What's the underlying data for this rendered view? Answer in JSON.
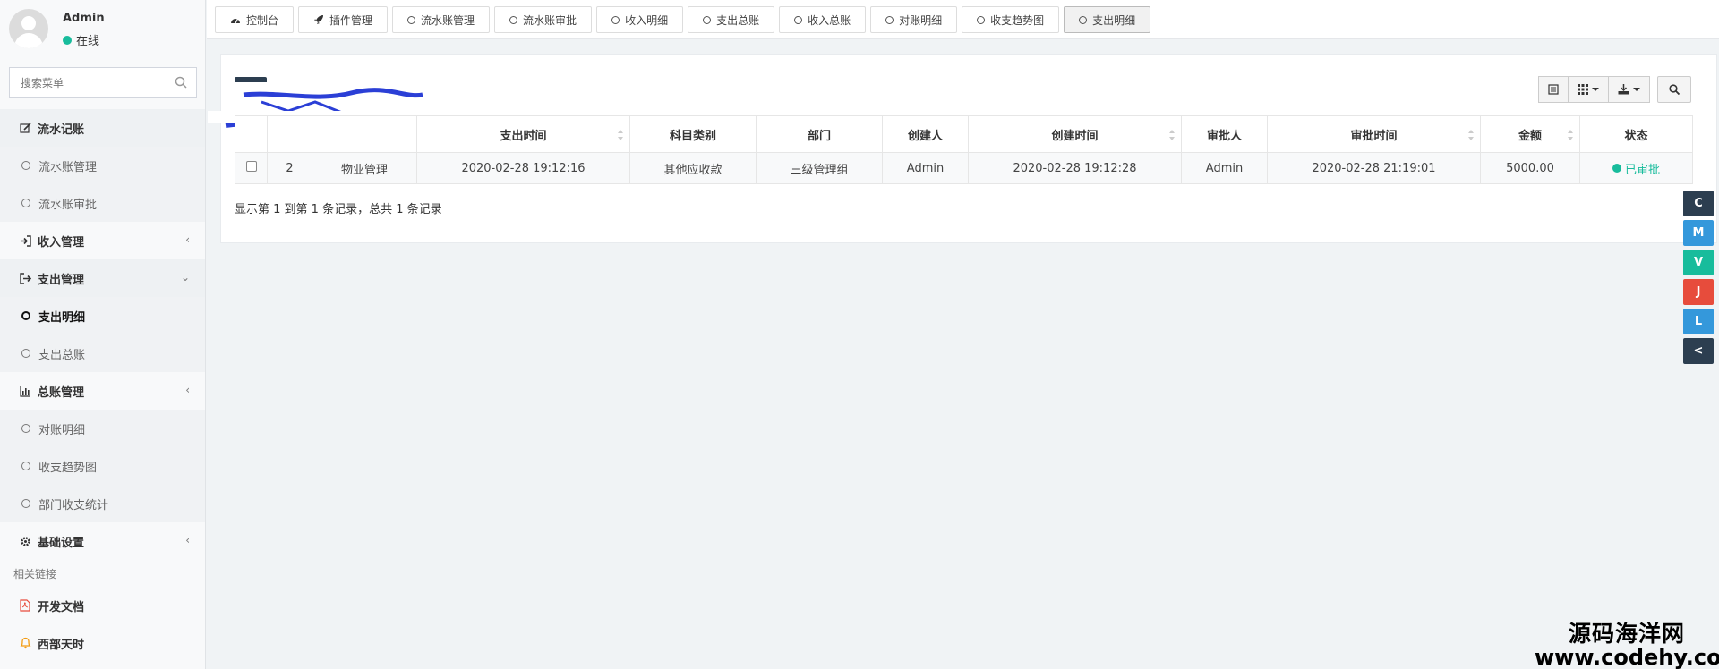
{
  "user": {
    "name": "Admin",
    "status": "在线",
    "status_color": "#18bc9c"
  },
  "sidebar": {
    "search_placeholder": "搜索菜单",
    "items": [
      {
        "label": "流水记账",
        "type": "parent",
        "icon": "edit-icon",
        "open": true
      },
      {
        "label": "流水账管理",
        "type": "child"
      },
      {
        "label": "流水账审批",
        "type": "child"
      },
      {
        "label": "收入管理",
        "type": "parent",
        "icon": "sign-in-icon",
        "arrow": "‹"
      },
      {
        "label": "支出管理",
        "type": "parent",
        "icon": "sign-out-icon",
        "arrow": "⌄",
        "open": true
      },
      {
        "label": "支出明细",
        "type": "child",
        "active": true
      },
      {
        "label": "支出总账",
        "type": "child"
      },
      {
        "label": "总账管理",
        "type": "parent",
        "icon": "bar-chart-icon",
        "arrow": "‹"
      },
      {
        "label": "对账明细",
        "type": "child"
      },
      {
        "label": "收支趋势图",
        "type": "child"
      },
      {
        "label": "部门收支统计",
        "type": "child"
      },
      {
        "label": "基础设置",
        "type": "parent",
        "icon": "gear-icon",
        "arrow": "‹"
      }
    ],
    "links_header": "相关链接",
    "links": [
      {
        "label": "开发文档",
        "icon": "pdf-icon"
      },
      {
        "label": "西部天时",
        "icon": "bell-icon"
      }
    ]
  },
  "tabs": [
    {
      "label": "控制台",
      "icon": "dashboard-icon"
    },
    {
      "label": "插件管理",
      "icon": "rocket-icon"
    },
    {
      "label": "流水账管理",
      "icon": "circle-icon"
    },
    {
      "label": "流水账审批",
      "icon": "circle-icon"
    },
    {
      "label": "收入明细",
      "icon": "circle-icon"
    },
    {
      "label": "支出总账",
      "icon": "circle-icon"
    },
    {
      "label": "收入总账",
      "icon": "circle-icon"
    },
    {
      "label": "对账明细",
      "icon": "circle-icon"
    },
    {
      "label": "收支趋势图",
      "icon": "circle-icon"
    },
    {
      "label": "支出明细",
      "icon": "circle-icon",
      "active": true
    }
  ],
  "table": {
    "columns": [
      "",
      "",
      "",
      "支出时间",
      "科目类别",
      "部门",
      "创建人",
      "创建时间",
      "审批人",
      "审批时间",
      "金额",
      "状态"
    ],
    "rows": [
      [
        "",
        "2",
        "物业管理",
        "2020-02-28 19:12:16",
        "其他应收款",
        "三级管理组",
        "Admin",
        "2020-02-28 19:12:28",
        "Admin",
        "2020-02-28 21:19:01",
        "5000.00",
        "已审批"
      ]
    ]
  },
  "pagination": {
    "info": "显示第 1 到第 1 条记录，总共 1 条记录"
  },
  "float_buttons": [
    {
      "label": "C",
      "color": "#2c3e50"
    },
    {
      "label": "M",
      "color": "#3498db"
    },
    {
      "label": "V",
      "color": "#18bc9c"
    },
    {
      "label": "J",
      "color": "#e74c3c"
    },
    {
      "label": "L",
      "color": "#3498db"
    },
    {
      "label": "<",
      "color": "#2c3e50"
    }
  ],
  "watermark": {
    "line1": "源码海洋网",
    "line2": "www.codehy.com"
  }
}
